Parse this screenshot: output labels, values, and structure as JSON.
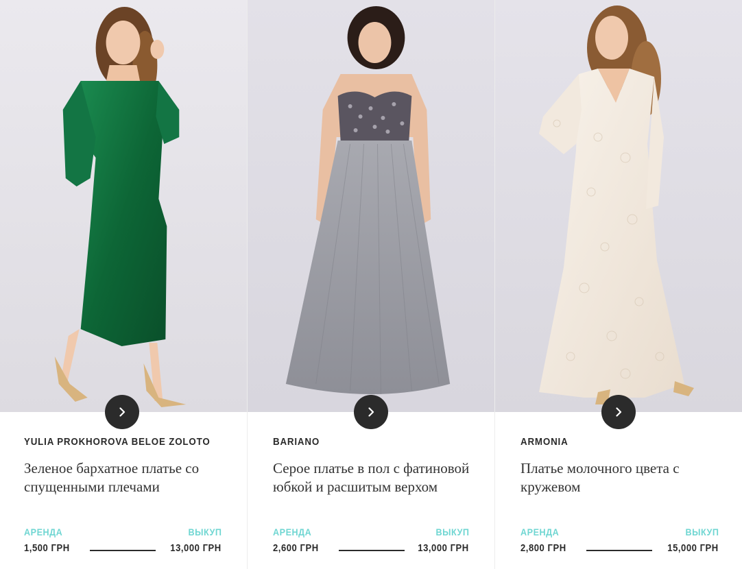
{
  "labels": {
    "rent": "АРЕНДА",
    "buy": "ВЫКУП"
  },
  "products": [
    {
      "brand": "YULIA PROKHOROVA BELOE ZOLOTO",
      "title": "Зеленое бархатное платье со спущенными плечами",
      "rent_price": "1,500 ГРН",
      "buy_price": "13,000 ГРН",
      "dress_color": "#0f6b3c",
      "image_desc": "green-velvet-dress-photo"
    },
    {
      "brand": "BARIANO",
      "title": "Серое платье в пол с фатиновой юбкой и расшитым верхом",
      "rent_price": "2,600 ГРН",
      "buy_price": "13,000 ГРН",
      "dress_color": "#9a9ba2",
      "image_desc": "grey-tulle-gown-photo"
    },
    {
      "brand": "ARMONIA",
      "title": "Платье молочного цвета с кружевом",
      "rent_price": "2,800 ГРН",
      "buy_price": "15,000 ГРН",
      "dress_color": "#f1e9df",
      "image_desc": "ivory-lace-dress-photo"
    }
  ],
  "colors": {
    "accent": "#6fd6d2",
    "text": "#2a2a2a",
    "button": "#2b2b2b",
    "background_photo": "#e6e4e8"
  },
  "icons": {
    "next": "chevron-right-icon"
  }
}
